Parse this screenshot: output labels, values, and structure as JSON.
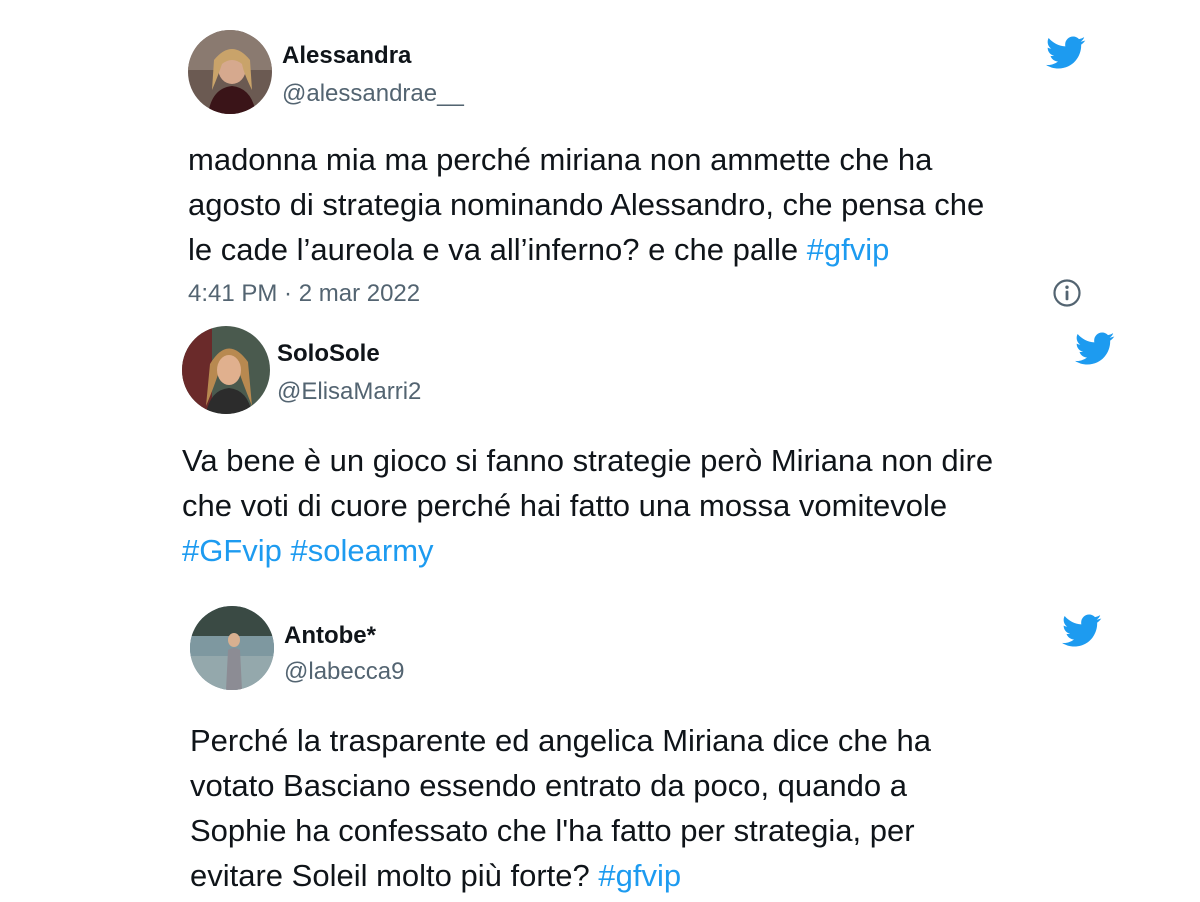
{
  "colors": {
    "accent": "#1d9bf0",
    "text": "#0f1419",
    "secondary": "#536471"
  },
  "icons": {
    "brand": "twitter-bird-icon",
    "info": "info-icon"
  },
  "tweets": [
    {
      "name": "Alessandra",
      "handle": "@alessandrae__",
      "lines": [
        [
          "madonna mia ma perché miriana non ammette che ha"
        ],
        [
          "agosto di strategia nominando Alessandro, che pensa che"
        ],
        [
          "le cade l’aureola e va all’inferno? e che palle ",
          "#gfvip"
        ]
      ],
      "time": "4:41 PM · 2 mar 2022"
    },
    {
      "name": "SoloSole",
      "handle": "@ElisaMarri2",
      "lines": [
        [
          "Va bene è un gioco si fanno strategie però Miriana non dire"
        ],
        [
          "che voti di cuore perché hai fatto una mossa vomitevole"
        ],
        [
          "",
          "#GFvip",
          " ",
          "#solearmy"
        ]
      ]
    },
    {
      "name": "Antobe*",
      "handle": "@labecca9",
      "lines": [
        [
          "Perché la trasparente ed angelica Miriana dice che ha"
        ],
        [
          "votato Basciano essendo entrato da poco, quando a"
        ],
        [
          "Sophie ha confessato che l'ha fatto per strategia, per"
        ],
        [
          "evitare Soleil molto più forte? ",
          "#gfvip"
        ]
      ]
    }
  ]
}
